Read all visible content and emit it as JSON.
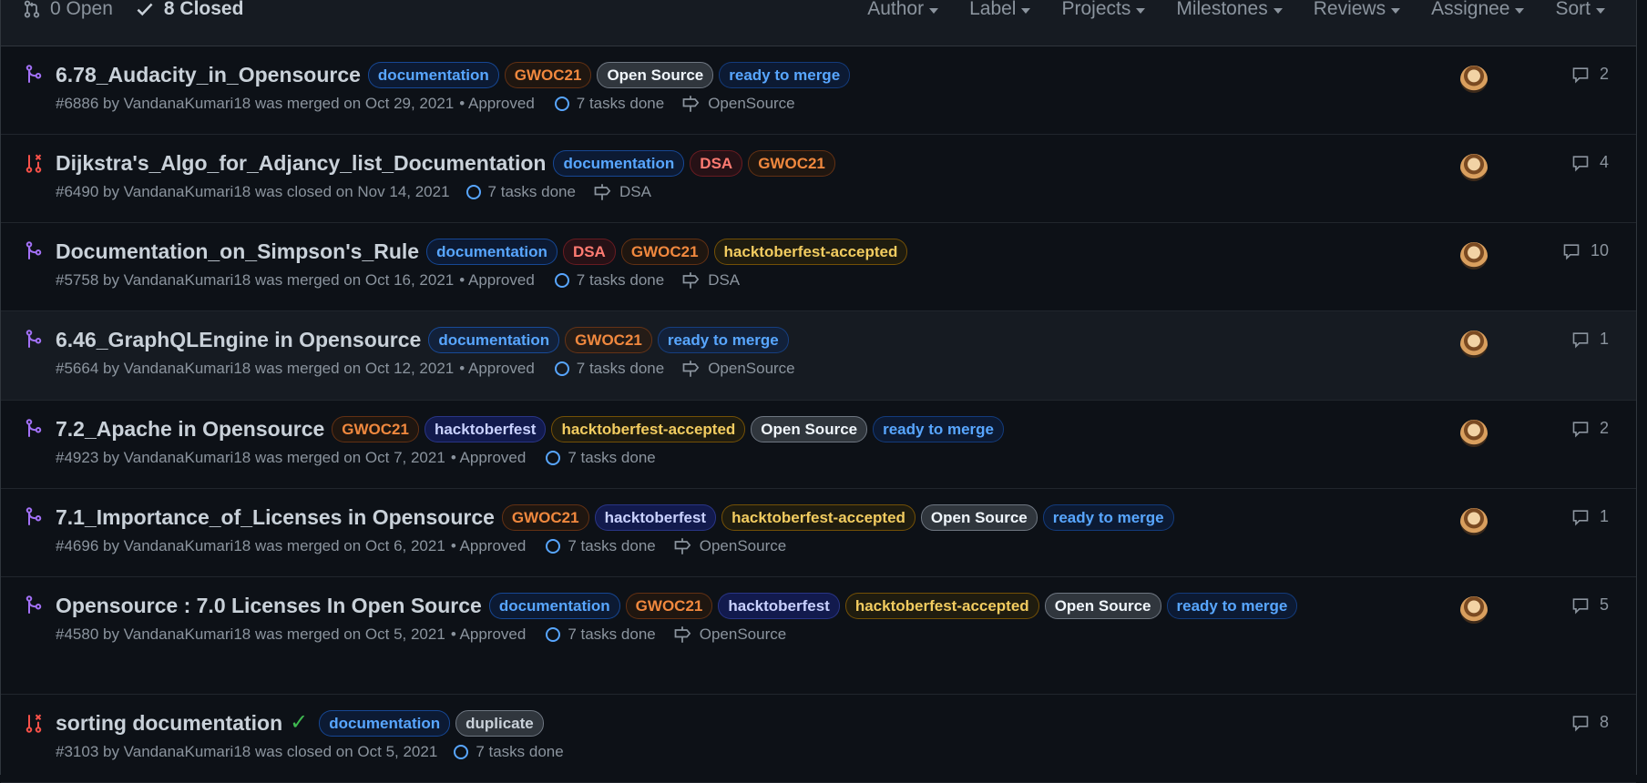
{
  "header": {
    "open_label": "0 Open",
    "closed_label": "8 Closed",
    "filters": [
      "Author",
      "Label",
      "Projects",
      "Milestones",
      "Reviews",
      "Assignee",
      "Sort"
    ]
  },
  "prs": [
    {
      "title": "6.78_Audacity_in_Opensource",
      "state": "merged",
      "labels": [
        {
          "text": "documentation",
          "cls": "l-doc"
        },
        {
          "text": "GWOC21",
          "cls": "l-gwoc"
        },
        {
          "text": "Open Source",
          "cls": "l-os"
        },
        {
          "text": "ready to merge",
          "cls": "l-rtm"
        }
      ],
      "meta": "#6886 by VandanaKumari18 was merged on Oct 29, 2021",
      "approved": "• Approved",
      "tasks": "7 tasks done",
      "milestone": "OpenSource",
      "comments": "2"
    },
    {
      "title": "Dijkstra's_Algo_for_Adjancy_list_Documentation",
      "state": "closed",
      "labels": [
        {
          "text": "documentation",
          "cls": "l-doc"
        },
        {
          "text": "DSA",
          "cls": "l-dsa"
        },
        {
          "text": "GWOC21",
          "cls": "l-gwoc"
        }
      ],
      "meta": "#6490 by VandanaKumari18 was closed on Nov 14, 2021",
      "approved": "",
      "tasks": "7 tasks done",
      "milestone": "DSA",
      "comments": "4"
    },
    {
      "title": "Documentation_on_Simpson's_Rule",
      "state": "merged",
      "labels": [
        {
          "text": "documentation",
          "cls": "l-doc"
        },
        {
          "text": "DSA",
          "cls": "l-dsa"
        },
        {
          "text": "GWOC21",
          "cls": "l-gwoc"
        },
        {
          "text": "hacktoberfest-accepted",
          "cls": "l-hta"
        }
      ],
      "meta": "#5758 by VandanaKumari18 was merged on Oct 16, 2021",
      "approved": "• Approved",
      "tasks": "7 tasks done",
      "milestone": "DSA",
      "comments": "10"
    },
    {
      "title": "6.46_GraphQLEngine in Opensource",
      "state": "merged",
      "highlight": true,
      "labels": [
        {
          "text": "documentation",
          "cls": "l-doc"
        },
        {
          "text": "GWOC21",
          "cls": "l-gwoc"
        },
        {
          "text": "ready to merge",
          "cls": "l-rtm"
        }
      ],
      "meta": "#5664 by VandanaKumari18 was merged on Oct 12, 2021",
      "approved": "• Approved",
      "tasks": "7 tasks done",
      "milestone": "OpenSource",
      "comments": "1"
    },
    {
      "title": "7.2_Apache in Opensource",
      "state": "merged",
      "labels": [
        {
          "text": "GWOC21",
          "cls": "l-gwoc"
        },
        {
          "text": "hacktoberfest",
          "cls": "l-ht"
        },
        {
          "text": "hacktoberfest-accepted",
          "cls": "l-hta"
        },
        {
          "text": "Open Source",
          "cls": "l-os"
        },
        {
          "text": "ready to merge",
          "cls": "l-rtm"
        }
      ],
      "meta": "#4923 by VandanaKumari18 was merged on Oct 7, 2021",
      "approved": "• Approved",
      "tasks": "7 tasks done",
      "milestone": "",
      "comments": "2"
    },
    {
      "title": "7.1_Importance_of_Licenses in Opensource",
      "state": "merged",
      "labels": [
        {
          "text": "GWOC21",
          "cls": "l-gwoc"
        },
        {
          "text": "hacktoberfest",
          "cls": "l-ht"
        },
        {
          "text": "hacktoberfest-accepted",
          "cls": "l-hta"
        },
        {
          "text": "Open Source",
          "cls": "l-os"
        },
        {
          "text": "ready to merge",
          "cls": "l-rtm"
        }
      ],
      "meta": "#4696 by VandanaKumari18 was merged on Oct 6, 2021",
      "approved": "• Approved",
      "tasks": "7 tasks done",
      "milestone": "OpenSource",
      "comments": "1"
    },
    {
      "title": "Opensource : 7.0 Licenses In Open Source",
      "state": "merged",
      "labels": [
        {
          "text": "documentation",
          "cls": "l-doc"
        },
        {
          "text": "GWOC21",
          "cls": "l-gwoc"
        },
        {
          "text": "hacktoberfest",
          "cls": "l-ht"
        },
        {
          "text": "hacktoberfest-accepted",
          "cls": "l-hta"
        },
        {
          "text": "Open Source",
          "cls": "l-os"
        },
        {
          "text": "ready to merge",
          "cls": "l-rtm"
        }
      ],
      "meta": "#4580 by VandanaKumari18 was merged on Oct 5, 2021",
      "approved": "• Approved",
      "tasks": "7 tasks done",
      "milestone": "OpenSource",
      "comments": "5"
    },
    {
      "title": "sorting documentation",
      "state": "closed",
      "check": true,
      "labels": [
        {
          "text": "documentation",
          "cls": "l-doc"
        },
        {
          "text": "duplicate",
          "cls": "l-dup"
        }
      ],
      "meta": "#3103 by VandanaKumari18 was closed on Oct 5, 2021",
      "approved": "",
      "tasks": "7 tasks done",
      "milestone": "",
      "comments": "8"
    }
  ],
  "colors": {
    "merged": "#a371f7",
    "closed": "#f85149",
    "task_ring": "#58a6ff"
  }
}
